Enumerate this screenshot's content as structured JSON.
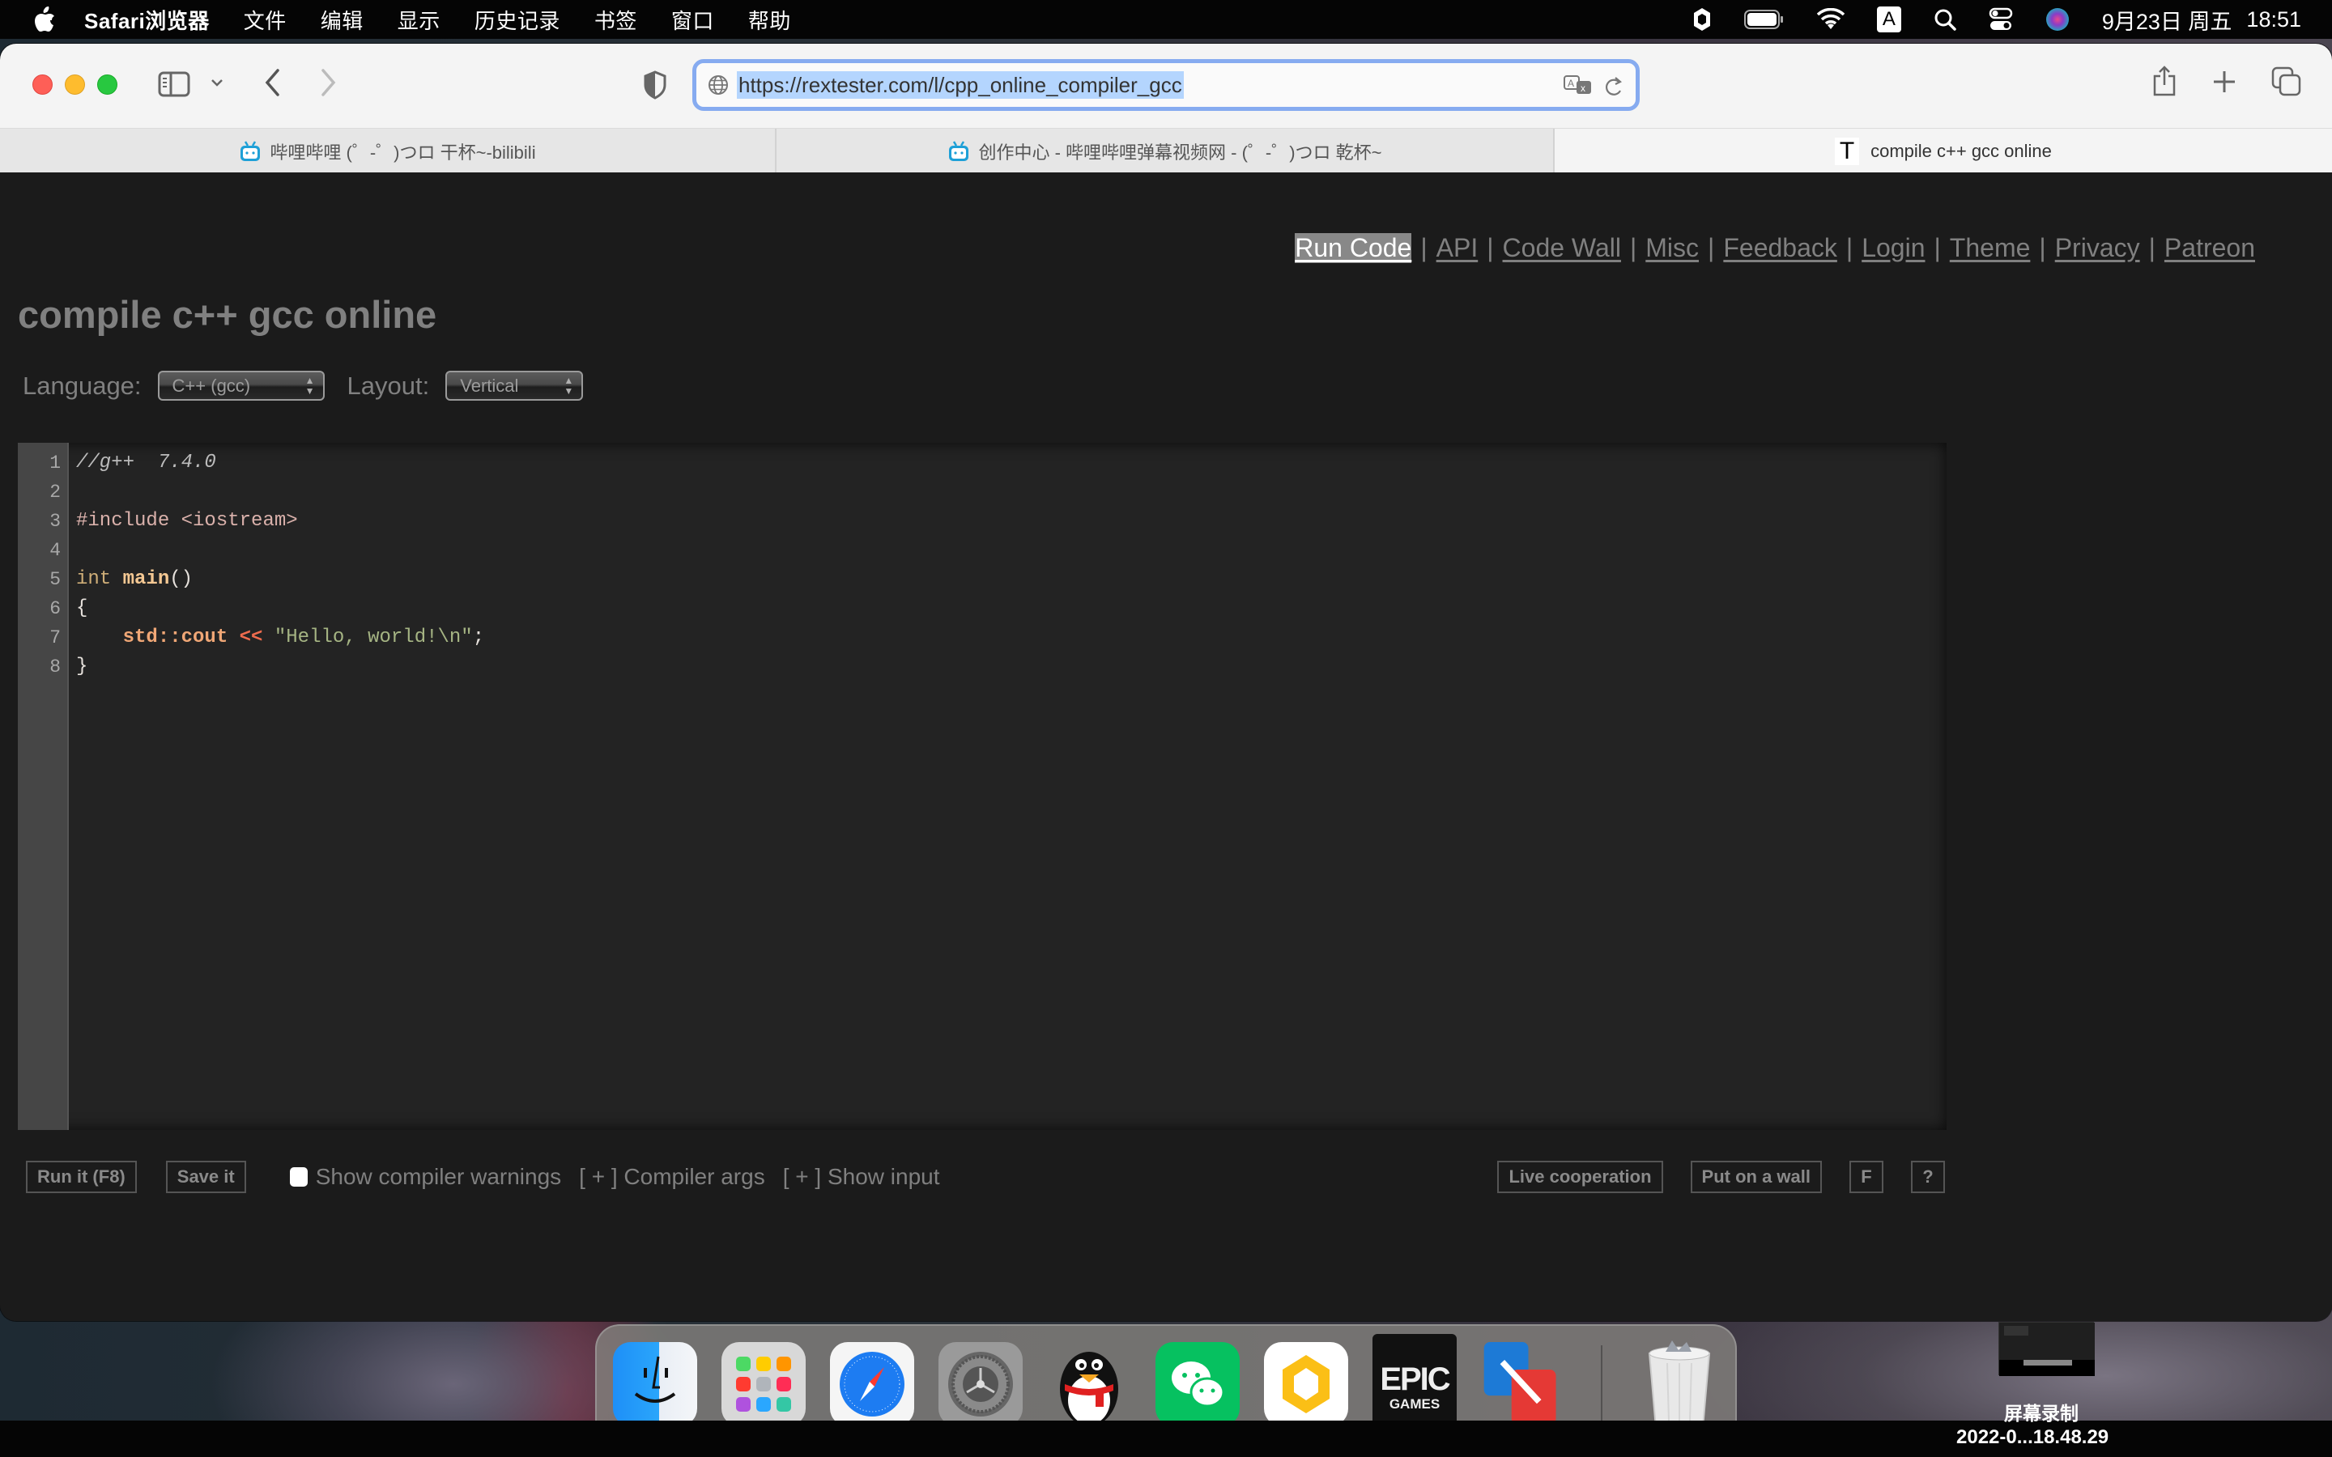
{
  "menubar": {
    "app_name": "Safari浏览器",
    "items": [
      "文件",
      "编辑",
      "显示",
      "历史记录",
      "书签",
      "窗口",
      "帮助"
    ],
    "status": {
      "input_method": "A",
      "date": "9月23日 周五",
      "time": "18:51"
    }
  },
  "browser": {
    "url": "https://rextester.com/l/cpp_online_compiler_gcc",
    "tabs": [
      {
        "title": "哔哩哔哩 (゜-゜)つロ 干杯~-bilibili",
        "icon": "bilibili-icon",
        "active": false
      },
      {
        "title": "创作中心 - 哔哩哔哩弹幕视频网 - (゜-゜)つロ 乾杯~",
        "icon": "bilibili-icon",
        "active": false
      },
      {
        "title": "compile c++ gcc online",
        "icon": "t-favicon",
        "active": true
      }
    ]
  },
  "page": {
    "nav": [
      {
        "label": "Run Code",
        "current": true
      },
      {
        "label": "API",
        "current": false
      },
      {
        "label": "Code Wall",
        "current": false
      },
      {
        "label": "Misc",
        "current": false
      },
      {
        "label": "Feedback",
        "current": false
      },
      {
        "label": "Login",
        "current": false
      },
      {
        "label": "Theme",
        "current": false
      },
      {
        "label": "Privacy",
        "current": false
      },
      {
        "label": "Patreon",
        "current": false
      }
    ],
    "nav_separator": "|",
    "title": "compile c++ gcc online",
    "language_label": "Language:",
    "language_value": "C++ (gcc)",
    "layout_label": "Layout:",
    "layout_value": "Vertical",
    "editor": {
      "line_numbers": [
        "1",
        "2",
        "3",
        "4",
        "5",
        "6",
        "7",
        "8"
      ],
      "lines": [
        {
          "comment": "//g++  7.4.0"
        },
        {},
        {
          "pre": "#include <iostream>"
        },
        {},
        {
          "type": "int",
          "space": " ",
          "func": "main",
          "punct": "()"
        },
        {
          "punct": "{"
        },
        {
          "indent": "    ",
          "id": "std::cout",
          "sp1": " ",
          "op": "<<",
          "sp2": " ",
          "str": "\"Hello, world!\\n\"",
          "end": ";"
        },
        {
          "punct": "}"
        }
      ]
    },
    "actions": {
      "run": "Run it (F8)",
      "save": "Save it",
      "warnings_label": "Show compiler warnings",
      "warnings_checked": false,
      "compiler_args": "[ + ] Compiler args",
      "show_input": "[ + ] Show input",
      "live_coop": "Live cooperation",
      "put_on_wall": "Put on a wall",
      "f": "F",
      "help": "?"
    }
  },
  "dock": {
    "apps": [
      "Finder",
      "Launchpad",
      "Safari",
      "System Preferences",
      "QQ",
      "WeChat",
      "Lingxi",
      "Epic Games",
      "Parallels/Remote",
      "Trash"
    ],
    "epic_line1": "EPIC",
    "epic_line2": "GAMES"
  },
  "screenshot_preview": {
    "label": "屏幕录制",
    "filename": "2022-0...18.48.29"
  }
}
